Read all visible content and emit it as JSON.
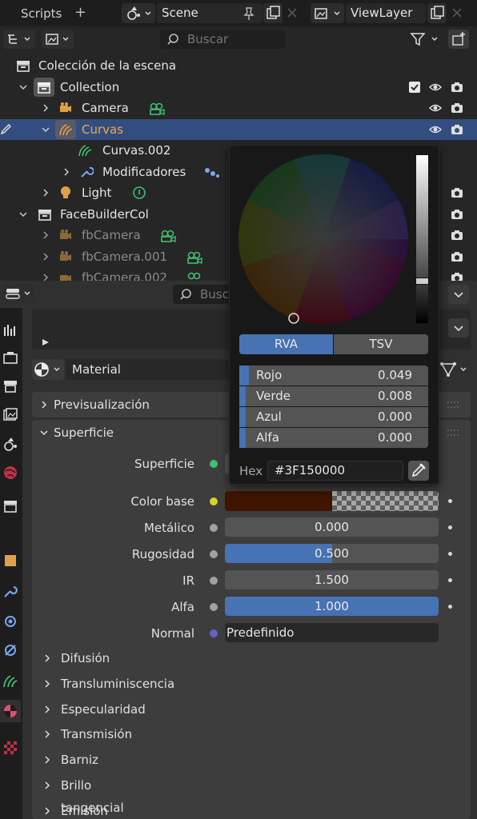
{
  "topbar": {
    "workspace_tab": "Scripts",
    "add_tab": "+",
    "scene": "Scene",
    "view_layer": "ViewLayer"
  },
  "outliner": {
    "search_placeholder": "Buscar",
    "rows": [
      {
        "label": "Colección de la escena"
      },
      {
        "label": "Collection"
      },
      {
        "label": "Camera"
      },
      {
        "label": "Curvas"
      },
      {
        "label": "Curvas.002"
      },
      {
        "label": "Modificadores"
      },
      {
        "label": "Light"
      },
      {
        "label": "FaceBuilderCol"
      },
      {
        "label": "fbCamera"
      },
      {
        "label": "fbCamera.001"
      },
      {
        "label": "fbCamera.002"
      }
    ]
  },
  "properties": {
    "search_placeholder": "Buscar",
    "material_slot": "Material",
    "panels": {
      "preview": "Previsualización",
      "surface": "Superficie"
    },
    "fields": {
      "surface_label": "Superficie",
      "base_color_label": "Color base",
      "metallic_label": "Metálico",
      "metallic_value": "0.000",
      "metallic_fraction": 0.0,
      "roughness_label": "Rugosidad",
      "roughness_value": "0.500",
      "roughness_fraction": 0.5,
      "ior_label": "IR",
      "ior_value": "1.500",
      "ior_fraction": 0.0,
      "alpha_label": "Alfa",
      "alpha_value": "1.000",
      "alpha_fraction": 1.0,
      "normal_label": "Normal",
      "normal_value": "Predefinido"
    },
    "subpanels": [
      "Difusión",
      "Transluminiscencia",
      "Especularidad",
      "Transmisión",
      "Barniz",
      "Brillo tangencial",
      "Emisión"
    ]
  },
  "picker": {
    "mode_tabs": [
      "RVA",
      "TSV"
    ],
    "active_mode": "RVA",
    "rows": [
      {
        "label": "Rojo",
        "value": "0.049",
        "fraction": 0.049
      },
      {
        "label": "Verde",
        "value": "0.008",
        "fraction": 0.008
      },
      {
        "label": "Azul",
        "value": "0.000",
        "fraction": 0.0
      },
      {
        "label": "Alfa",
        "value": "0.000",
        "fraction": 0.0
      }
    ],
    "hex_label": "Hex",
    "hex_value": "#3F150000",
    "base_color_swatch": "#3f1500"
  },
  "colors": {
    "selection": "#334d80",
    "accent": "#4772b3",
    "curve_green": "#3fbf6f",
    "orange_object": "#e0a04a"
  }
}
